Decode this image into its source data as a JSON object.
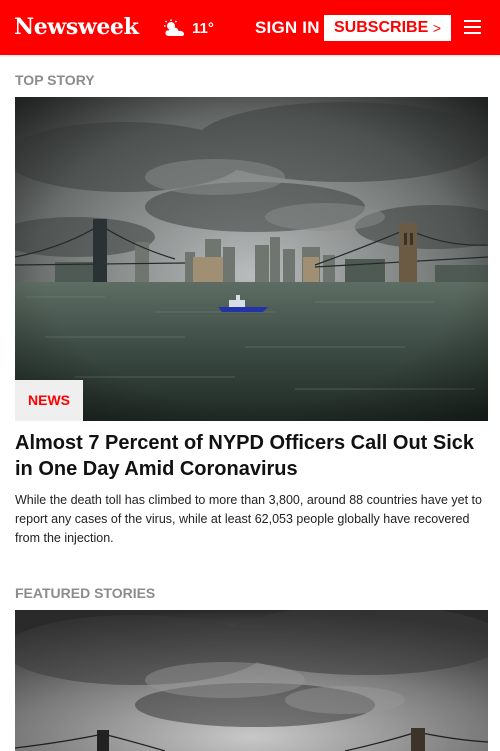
{
  "header": {
    "logo": "Newsweek",
    "weather": {
      "icon": "partly-cloudy-icon",
      "temperature": "11°"
    },
    "sign_in": "SIGN IN",
    "subscribe": "SUBSCRIBE",
    "subscribe_chevron": ">",
    "menu_icon": "hamburger-icon",
    "brand_color": "#ff0000"
  },
  "top_story": {
    "section_label": "TOP STORY",
    "tag": "NEWS",
    "headline": "Almost 7 Percent of NYPD Officers Call Out Sick in One Day Amid Coronavirus",
    "summary": "While the death toll has climbed to more than 3,800, around 88 countries have yet to report any cases of the virus, while at least 62,053 people globally have recovered from the injection."
  },
  "featured": {
    "section_label": "FEATURED STORIES"
  }
}
